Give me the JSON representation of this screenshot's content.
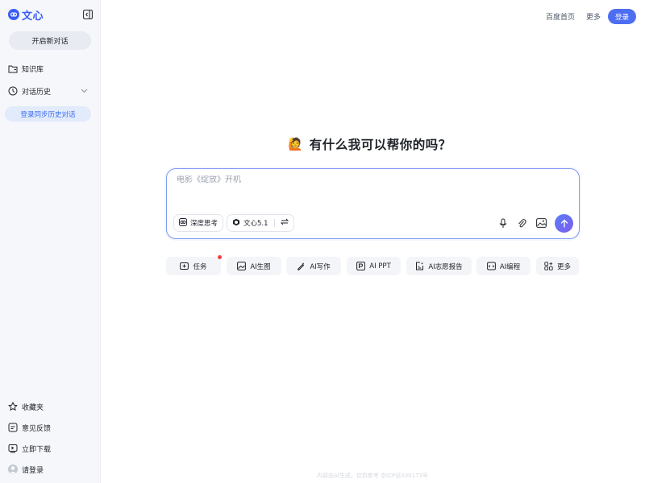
{
  "sidebar": {
    "logo_text": "文心",
    "new_chat_label": "开启新对话",
    "knowledge_base_label": "知识库",
    "history_label": "对话历史",
    "sync_label": "登录同步历史对话",
    "favorites_label": "收藏夹",
    "feedback_label": "意见反馈",
    "download_label": "立即下载",
    "login_label": "请登录"
  },
  "header": {
    "baidu_home_label": "百度首页",
    "more_label": "更多",
    "login_label": "登录"
  },
  "main": {
    "emoji": "🙋",
    "headline": "有什么我可以帮你的吗？",
    "input_placeholder": "电影《绽放》开机",
    "deep_think_label": "深度思考",
    "model_label": "文心5.1",
    "quick_actions": [
      {
        "label": "任务",
        "icon": "task-icon"
      },
      {
        "label": "AI生图",
        "icon": "image-gen-icon"
      },
      {
        "label": "AI写作",
        "icon": "pen-icon"
      },
      {
        "label": "AI PPT",
        "icon": "ppt-icon"
      },
      {
        "label": "AI志愿报告",
        "icon": "report-icon"
      },
      {
        "label": "AI编程",
        "icon": "code-icon"
      },
      {
        "label": "更多",
        "icon": "grid-icon"
      }
    ],
    "footer_note": "内容由AI生成，仅供参考 京ICP证030173号"
  },
  "colors": {
    "accent": "#4e6ef2",
    "brand": "#3a5cf5",
    "sidebar_bg": "#f5f7fa",
    "notification": "#f53f3f"
  }
}
